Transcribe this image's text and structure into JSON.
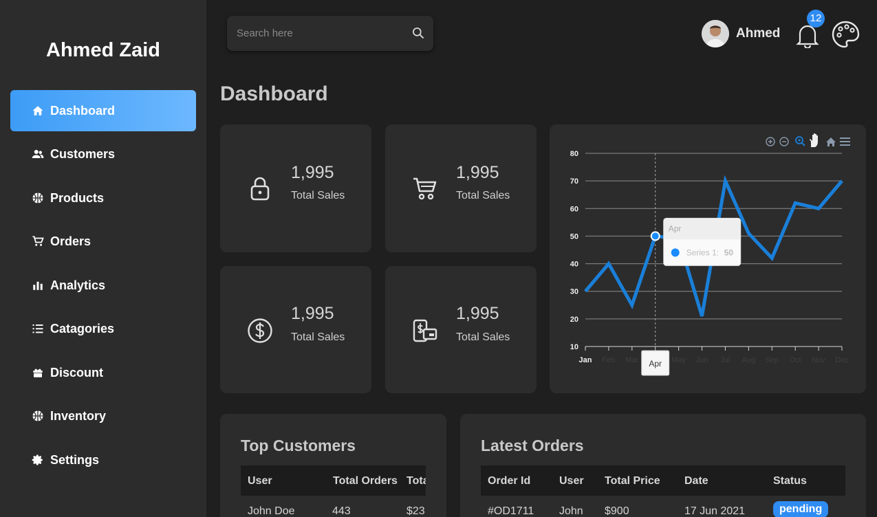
{
  "brand": "Ahmed Zaid",
  "sidebar": {
    "items": [
      {
        "label": "Dashboard",
        "icon": "home-icon"
      },
      {
        "label": "Customers",
        "icon": "users-icon"
      },
      {
        "label": "Products",
        "icon": "basketball-icon"
      },
      {
        "label": "Orders",
        "icon": "cart-icon"
      },
      {
        "label": "Analytics",
        "icon": "bar-chart-icon"
      },
      {
        "label": "Catagories",
        "icon": "list-icon"
      },
      {
        "label": "Discount",
        "icon": "gift-icon"
      },
      {
        "label": "Inventory",
        "icon": "basketball-icon"
      },
      {
        "label": "Settings",
        "icon": "gear-icon"
      }
    ],
    "active": "Dashboard"
  },
  "search": {
    "placeholder": "Search here"
  },
  "user": {
    "name": "Ahmed"
  },
  "notifications": {
    "count": "12"
  },
  "page_title": "Dashboard",
  "stats": [
    {
      "value": "1,995",
      "label": "Total Sales",
      "icon": "lock-icon"
    },
    {
      "value": "1,995",
      "label": "Total Sales",
      "icon": "cart-icon"
    },
    {
      "value": "1,995",
      "label": "Total Sales",
      "icon": "dollar-icon"
    },
    {
      "value": "1,995",
      "label": "Total Sales",
      "icon": "payment-icon"
    }
  ],
  "chart_data": {
    "type": "line",
    "categories": [
      "Jan",
      "Feb",
      "Mar",
      "Apr",
      "May",
      "Jun",
      "Jul",
      "Aug",
      "Sep",
      "Oct",
      "Nov",
      "Dec"
    ],
    "series": [
      {
        "name": "Series 1",
        "values": [
          30,
          40,
          25,
          50,
          49,
          21,
          70,
          51,
          42,
          62,
          60,
          70
        ]
      }
    ],
    "ylim": [
      10,
      80
    ],
    "yticks": [
      10,
      20,
      30,
      40,
      50,
      60,
      70,
      80
    ],
    "grid": true,
    "color": "#1a7fd8",
    "tooltip": {
      "category": "Apr",
      "series": "Series 1:",
      "value": "50"
    },
    "toolbar_icons": [
      "zoom-in-icon",
      "zoom-out-icon",
      "zoom-select-icon",
      "pan-hand-icon",
      "reset-home-icon",
      "menu-icon"
    ]
  },
  "top_customers": {
    "title": "Top Customers",
    "headers": [
      "User",
      "Total Orders",
      "Total"
    ],
    "rows": [
      [
        "John Doe",
        "443",
        "$23"
      ]
    ]
  },
  "latest_orders": {
    "title": "Latest Orders",
    "headers": [
      "Order Id",
      "User",
      "Total Price",
      "Date",
      "Status"
    ],
    "rows": [
      [
        "#OD1711",
        "John",
        "$900",
        "17 Jun 2021",
        "pending"
      ]
    ]
  }
}
